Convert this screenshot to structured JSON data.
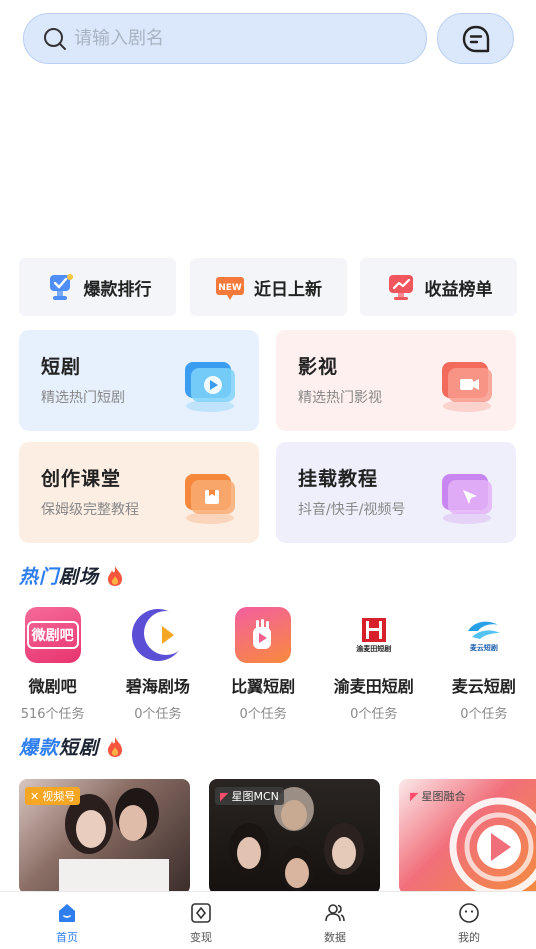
{
  "search": {
    "placeholder": "请输入剧名"
  },
  "quick_buttons": [
    {
      "label": "爆款排行",
      "icon": "trophy-icon"
    },
    {
      "label": "近日上新",
      "icon": "new-badge-icon"
    },
    {
      "label": "收益榜单",
      "icon": "chart-rise-icon"
    }
  ],
  "cards": [
    {
      "title": "短剧",
      "subtitle": "精选热门短剧",
      "icon": "play-video-icon"
    },
    {
      "title": "影视",
      "subtitle": "精选热门影视",
      "icon": "camera-video-icon"
    },
    {
      "title": "创作课堂",
      "subtitle": "保姆级完整教程",
      "icon": "course-book-icon"
    },
    {
      "title": "挂载教程",
      "subtitle": "抖音/快手/视频号",
      "icon": "cursor-arrow-icon"
    }
  ],
  "hot_theater": {
    "title_highlight": "热门",
    "title_rest": "剧场"
  },
  "theaters": [
    {
      "name": "微剧吧",
      "count": "516个任务",
      "logo_text": "微剧吧"
    },
    {
      "name": "碧海剧场",
      "count": "0个任务",
      "logo_text": ""
    },
    {
      "name": "比翼短剧",
      "count": "0个任务",
      "logo_text": ""
    },
    {
      "name": "渝麦田短剧",
      "count": "0个任务",
      "logo_text": "渝麦田短剧"
    },
    {
      "name": "麦云短剧",
      "count": "0个任务",
      "logo_text": "麦云短剧"
    }
  ],
  "hot_drama": {
    "title_highlight": "爆款",
    "title_rest": "短剧"
  },
  "posters": [
    {
      "tag": "视频号",
      "tag_color": "#f5a623"
    },
    {
      "tag": "星图MCN",
      "tag_color": "#3a3a3a"
    },
    {
      "tag": "星图融合",
      "tag_color": "#3a3a3a"
    }
  ],
  "bottom_nav": [
    {
      "label": "首页",
      "icon": "home-icon",
      "active": true
    },
    {
      "label": "变现",
      "icon": "monetize-icon",
      "active": false
    },
    {
      "label": "数据",
      "icon": "users-icon",
      "active": false
    },
    {
      "label": "我的",
      "icon": "profile-face-icon",
      "active": false
    }
  ],
  "colors": {
    "accent": "#2e7ef0",
    "search_bg": "#dbe8fc"
  }
}
